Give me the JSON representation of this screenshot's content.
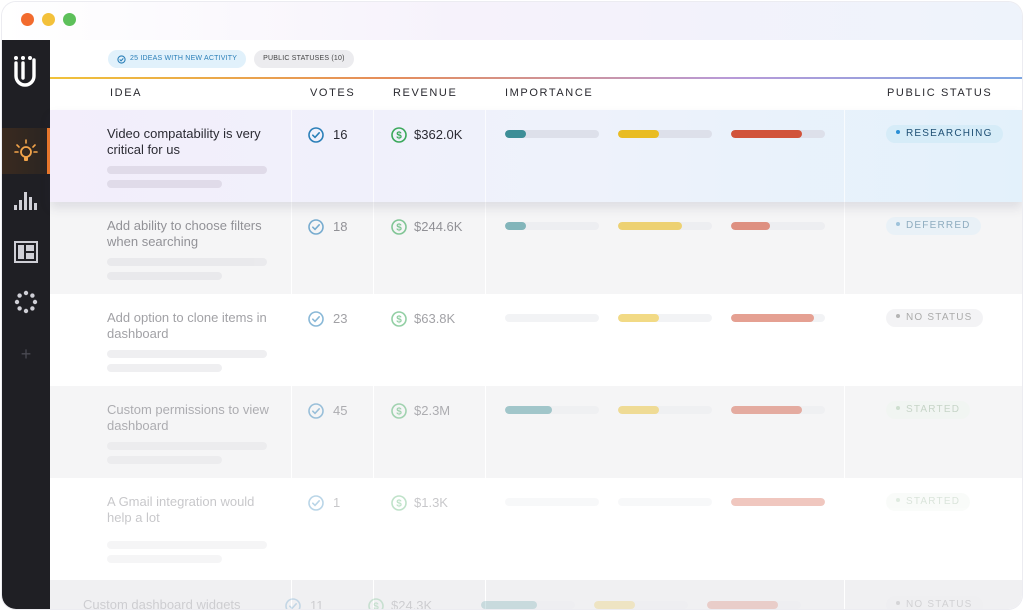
{
  "filters": [
    {
      "label": "25 IDEAS WITH NEW ACTIVITY",
      "icon": "check-circle-icon"
    },
    {
      "label": "PUBLIC STATUSES (10)"
    }
  ],
  "columns": {
    "idea": "IDEA",
    "votes": "VOTES",
    "revenue": "REVENUE",
    "importance": "IMPORTANCE",
    "status": "PUBLIC STATUS"
  },
  "sidebar": {
    "icons": [
      "logo-icon",
      "lightbulb-icon",
      "bar-chart-icon",
      "board-icon",
      "loading-dots-icon",
      "plus-icon"
    ],
    "plus": "+"
  },
  "rows": [
    {
      "title": "Video compatability is very critical for us",
      "votes": "16",
      "revenue": "$362.0K",
      "importance": [
        0.22,
        0.44,
        0.76
      ],
      "status": "RESEARCHING"
    },
    {
      "title": "Add ability to choose filters when searching",
      "votes": "18",
      "revenue": "$244.6K",
      "importance": [
        0.22,
        0.68,
        0.42
      ],
      "status": "DEFERRED"
    },
    {
      "title": "Add option to clone items in dashboard",
      "votes": "23",
      "revenue": "$63.8K",
      "importance": [
        0.0,
        0.44,
        0.88
      ],
      "status": "NO STATUS"
    },
    {
      "title": "Custom permissions to view dashboard",
      "votes": "45",
      "revenue": "$2.3M",
      "importance": [
        0.5,
        0.44,
        0.76
      ],
      "status": "STARTED"
    },
    {
      "title": "A Gmail integration would help a lot",
      "votes": "1",
      "revenue": "$1.3K",
      "importance": [
        0.0,
        0.0,
        1.0
      ],
      "status": "STARTED"
    },
    {
      "title": "Custom dashboard widgets",
      "votes": "11",
      "revenue": "$24.3K",
      "importance": [
        0.6,
        0.44,
        0.76
      ],
      "status": "NO STATUS"
    }
  ],
  "colors": {
    "bar1": "#3d8e97",
    "bar2": "#e9bc22",
    "bar3": "#d1533a",
    "track": "#e6e8ee"
  }
}
